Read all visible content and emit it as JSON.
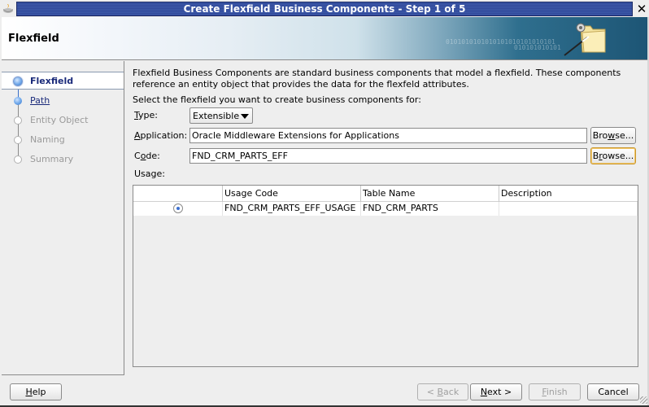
{
  "window": {
    "title": "Create Flexfield Business Components - Step 1 of 5",
    "close_glyph": "✕"
  },
  "header": {
    "title": "Flexfield",
    "binary_text_1": "0101010101010101010101010101",
    "binary_text_2": "010101010101"
  },
  "steps": [
    {
      "label": "Flexfield",
      "state": "current"
    },
    {
      "label": "Path",
      "state": "link"
    },
    {
      "label": "Entity Object",
      "state": "disabled"
    },
    {
      "label": "Naming",
      "state": "disabled"
    },
    {
      "label": "Summary",
      "state": "disabled"
    }
  ],
  "main": {
    "description": "Flexfield Business Components are standard business components that model a flexfield. These components reference an entity object that provides the data for the flexfeld attributes.",
    "select_hint": "Select the flexfield you want to create business components for:",
    "type": {
      "label_mnemonic": "T",
      "label_rest": "ype:",
      "value": "Extensible"
    },
    "application": {
      "label_mnemonic": "A",
      "label_rest": "pplication:",
      "value": "Oracle Middleware Extensions for Applications",
      "browse_label_pre": "Bro",
      "browse_label_mn": "w",
      "browse_label_post": "se..."
    },
    "code": {
      "label_pre": "C",
      "label_mnemonic": "o",
      "label_rest": "de:",
      "value": "FND_CRM_PARTS_EFF",
      "browse_label_pre": "B",
      "browse_label_mn": "r",
      "browse_label_post": "owse..."
    },
    "usage_label": "Usage:",
    "table": {
      "columns": [
        "",
        "Usage Code",
        "Table Name",
        "Description"
      ],
      "rows": [
        {
          "selected": true,
          "usage_code": "FND_CRM_PARTS_EFF_USAGE",
          "table_name": "FND_CRM_PARTS",
          "description": ""
        }
      ]
    }
  },
  "footer": {
    "help": {
      "mn": "H",
      "rest": "elp"
    },
    "back": {
      "pre": "< ",
      "mn": "B",
      "rest": "ack"
    },
    "next": {
      "mn": "N",
      "rest": "ext >"
    },
    "finish": {
      "mn": "F",
      "rest": "inish"
    },
    "cancel": "Cancel"
  }
}
